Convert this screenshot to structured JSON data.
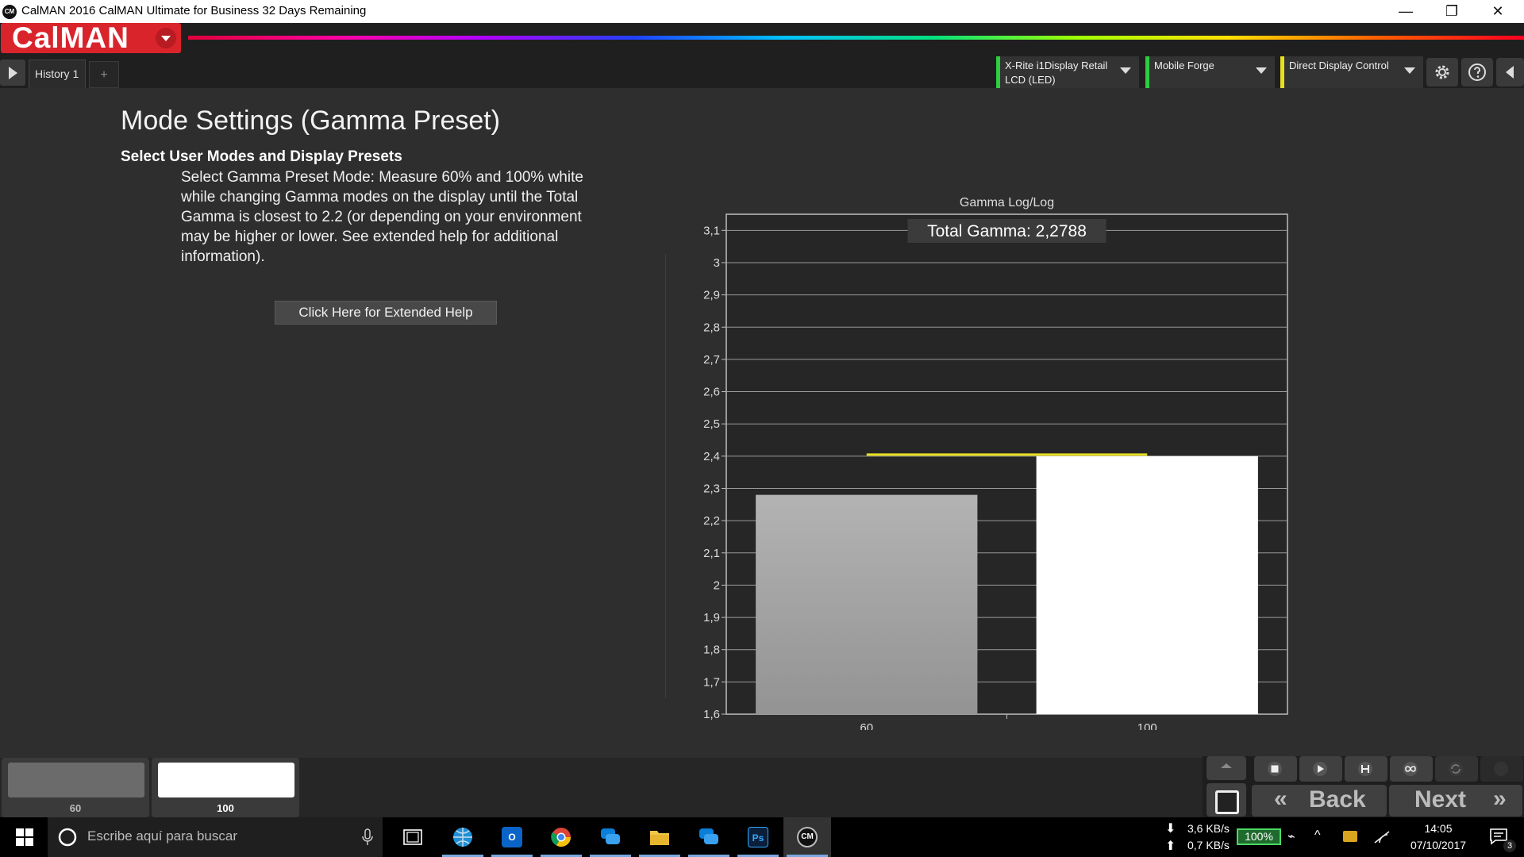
{
  "window": {
    "title": "CalMAN 2016 CalMAN Ultimate for Business 32 Days Remaining",
    "icon_text": "CM",
    "minimize": "—",
    "restore": "❐",
    "close": "✕"
  },
  "header": {
    "logo": "CalMAN",
    "tabs": [
      {
        "label": "History 1"
      }
    ],
    "add_tab": "+",
    "meter": {
      "line1": "X-Rite i1Display Retail",
      "line2": "LCD (LED)"
    },
    "source": {
      "label": "Mobile Forge"
    },
    "display": {
      "label": "Direct Display Control"
    },
    "status_colors": {
      "meter": "#2ecc40",
      "source": "#2ecc40",
      "display": "#e8e020"
    }
  },
  "main": {
    "title": "Mode Settings (Gamma Preset)",
    "subheading": "Select User Modes and Display Presets",
    "description": "Select Gamma Preset Mode: Measure 60% and 100% white while changing Gamma modes on the display until the Total Gamma is closest to 2.2 (or depending on your environment may be higher or lower. See extended help for additional information).",
    "help_button": "Click Here for Extended Help"
  },
  "chart_data": {
    "type": "bar",
    "title": "Gamma Log/Log",
    "annotation": "Total Gamma: 2,2788",
    "categories": [
      "60",
      "100"
    ],
    "values": [
      2.28,
      2.4
    ],
    "reference_line": {
      "value": 2.4,
      "color": "#e8e020"
    },
    "ylim": [
      1.6,
      3.15
    ],
    "yticks": [
      1.6,
      1.7,
      1.8,
      1.9,
      2.0,
      2.1,
      2.2,
      2.3,
      2.4,
      2.5,
      2.6,
      2.7,
      2.8,
      2.9,
      3.0,
      3.1
    ],
    "ytick_labels": [
      "1,6",
      "1,7",
      "1,8",
      "1,9",
      "2",
      "2,1",
      "2,2",
      "2,3",
      "2,4",
      "2,5",
      "2,6",
      "2,7",
      "2,8",
      "2,9",
      "3",
      "3,1"
    ],
    "bar_colors": [
      "#a6a6a6",
      "#ffffff"
    ],
    "grid": true,
    "xlabel": "",
    "ylabel": ""
  },
  "thumbnails": [
    {
      "label": "60",
      "color": "#6b6b6b"
    },
    {
      "label": "100",
      "color": "#ffffff"
    }
  ],
  "controls": {
    "back": "Back",
    "next": "Next",
    "back_arrows": "«",
    "next_arrows": "»"
  },
  "taskbar": {
    "search_placeholder": "Escribe aquí para buscar",
    "apps": [
      {
        "name": "task-view"
      },
      {
        "name": "app-globe"
      },
      {
        "name": "outlook",
        "text": "O"
      },
      {
        "name": "chrome"
      },
      {
        "name": "messenger-1"
      },
      {
        "name": "file-explorer"
      },
      {
        "name": "messenger-2"
      },
      {
        "name": "photoshop",
        "text": "Ps"
      },
      {
        "name": "calman",
        "text": "CM"
      }
    ],
    "net_down": "3,6 KB/s",
    "net_up": "0,7 KB/s",
    "battery": "100%",
    "time": "14:05",
    "date": "07/10/2017",
    "notifications": "3"
  }
}
